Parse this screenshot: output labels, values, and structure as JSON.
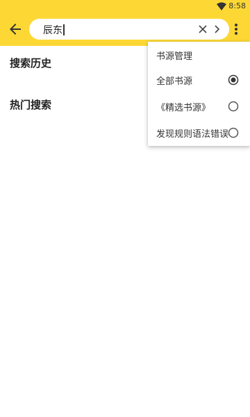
{
  "status_bar": {
    "time": "8:58",
    "wifi_icon": "wifi-icon"
  },
  "toolbar": {
    "back_icon": "arrow-back-icon",
    "search": {
      "value": "辰东",
      "placeholder": ""
    },
    "clear_icon": "close-icon",
    "submit_icon": "chevron-right-icon",
    "more_icon": "more-vert-icon"
  },
  "content": {
    "history_title": "搜索历史",
    "hot_title": "热门搜索"
  },
  "menu": {
    "header": "书源管理",
    "options": [
      {
        "label": "全部书源",
        "selected": true
      },
      {
        "label": "《精选书源》",
        "selected": false
      },
      {
        "label": "发现规则语法错误",
        "selected": false
      }
    ]
  },
  "colors": {
    "accent": "#FDD835"
  }
}
